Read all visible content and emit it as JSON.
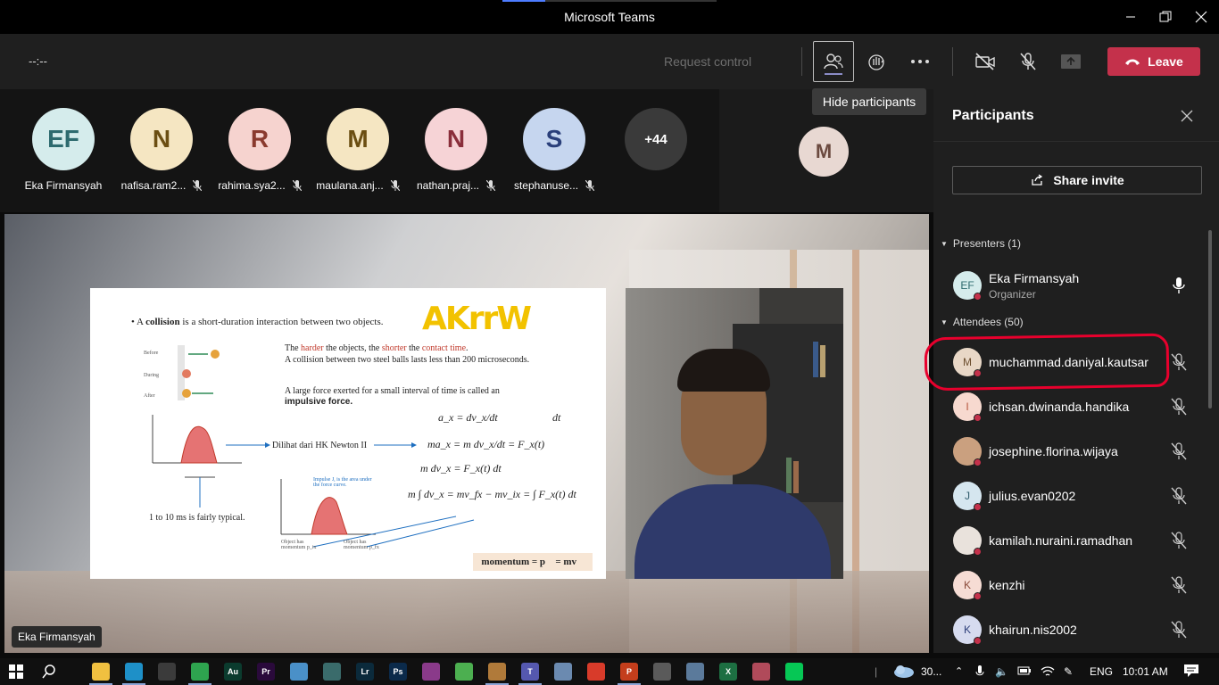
{
  "window": {
    "title": "Microsoft Teams"
  },
  "toolbar": {
    "timer": "--:--",
    "request_control": "Request control",
    "leave_label": "Leave",
    "tooltip": "Hide participants"
  },
  "strip": {
    "tiles": [
      {
        "initials": "EF",
        "name": "Eka Firmansyah",
        "bg": "#d5ecec",
        "fg": "#2e6b6f",
        "muted": false
      },
      {
        "initials": "N",
        "name": "nafisa.ram2...",
        "bg": "#f5e6c2",
        "fg": "#6b4e12",
        "muted": true
      },
      {
        "initials": "R",
        "name": "rahima.sya2...",
        "bg": "#f6d3cf",
        "fg": "#8a3a2e",
        "muted": true
      },
      {
        "initials": "M",
        "name": "maulana.anj...",
        "bg": "#f5e6c2",
        "fg": "#6b4e12",
        "muted": true
      },
      {
        "initials": "N",
        "name": "nathan.praj...",
        "bg": "#f6d3d6",
        "fg": "#8a2e3b",
        "muted": true
      },
      {
        "initials": "S",
        "name": "stephanuse...",
        "bg": "#c6d6ef",
        "fg": "#2a3f7a",
        "muted": true
      }
    ],
    "overflow": "+44",
    "right_avatar": "M"
  },
  "stage": {
    "presenter_chip": "Eka Firmansyah",
    "slide": {
      "bullet_pre": "A ",
      "bullet_bold": "collision",
      "bullet_post": " is a short-duration interaction between two objects.",
      "handwriting": "AKrrW",
      "line1_a": "The ",
      "line1_b": "harder",
      "line1_c": " the objects, the ",
      "line1_d": "shorter",
      "line1_e": " the ",
      "line1_f": "contact time",
      "line1_g": ".",
      "line2": "A collision between two steel balls lasts less than 200 microseconds.",
      "line3": "A large force exerted for a small interval of time is called an",
      "line4": "impulsive force.",
      "dilihat": "Dilihat dari HK Newton II",
      "typical": "1 to 10 ms is fairly typical.",
      "eq1": "a_x = dv_x/dt",
      "eq_dt": "dt",
      "eq2": "ma_x = m dv_x/dt = F_x(t)",
      "eq3": "m dv_x = F_x(t) dt",
      "eq4": "m ∫ dv_x = mv_fx − mv_ix = ∫ F_x(t) dt",
      "momentum": "momentum = p⃗ = mv⃗",
      "lbl_before": "Before",
      "lbl_during": "During",
      "lbl_after": "After",
      "lbl_impulse": "Impulse J, is the area under the force curve.",
      "lbl_obj1": "Object has momentum p_ix",
      "lbl_obj2": "Object has momentum p_fx"
    }
  },
  "panel": {
    "title": "Participants",
    "share_invite": "Share invite",
    "presenters_label": "Presenters (1)",
    "attendees_label": "Attendees (50)",
    "presenter": {
      "initials": "EF",
      "name": "Eka Firmansyah",
      "role": "Organizer"
    },
    "attendees": [
      {
        "initials": "M",
        "name": "muchammad.daniyal.kautsar",
        "bg": "#e8d7c6",
        "fg": "#6b4e2e"
      },
      {
        "initials": "I",
        "name": "ichsan.dwinanda.handika",
        "bg": "#f7d9cf",
        "fg": "#b5533b"
      },
      {
        "initials": "",
        "name": "josephine.florina.wijaya",
        "bg": "#caa07f",
        "fg": "#2b1d14"
      },
      {
        "initials": "J",
        "name": "julius.evan0202",
        "bg": "#d5e6ef",
        "fg": "#2e5a6b"
      },
      {
        "initials": "",
        "name": "kamilah.nuraini.ramadhan",
        "bg": "#e9e2dc",
        "fg": "#7a1d1d"
      },
      {
        "initials": "K",
        "name": "kenzhi",
        "bg": "#f6dcd4",
        "fg": "#8a4a3a"
      },
      {
        "initials": "K",
        "name": "khairun.nis2002",
        "bg": "#d6dbef",
        "fg": "#2e3f7a"
      }
    ]
  },
  "taskbar": {
    "icons": [
      {
        "name": "file-explorer-icon",
        "label": "",
        "color": "#f0c040"
      },
      {
        "name": "edge-icon",
        "label": "",
        "color": "#1e90c8"
      },
      {
        "name": "store-icon",
        "label": "",
        "color": "#3b3b3b"
      },
      {
        "name": "chrome-icon",
        "label": "",
        "color": "#2ea44f"
      },
      {
        "name": "audition-icon",
        "label": "Au",
        "color": "#0b3b2e"
      },
      {
        "name": "premiere-icon",
        "label": "Pr",
        "color": "#2a0a3b"
      },
      {
        "name": "notepad-icon",
        "label": "",
        "color": "#4a90c8"
      },
      {
        "name": "media-icon",
        "label": "",
        "color": "#3a6b6b"
      },
      {
        "name": "lightroom-icon",
        "label": "Lr",
        "color": "#0b2a3b"
      },
      {
        "name": "photoshop-icon",
        "label": "Ps",
        "color": "#0b2a4a"
      },
      {
        "name": "winrar-icon",
        "label": "",
        "color": "#8a3a8a"
      },
      {
        "name": "utorrent-icon",
        "label": "",
        "color": "#4caf50"
      },
      {
        "name": "app-icon",
        "label": "",
        "color": "#b07a3a"
      },
      {
        "name": "teams-icon",
        "label": "T",
        "color": "#5558af"
      },
      {
        "name": "paint-icon",
        "label": "",
        "color": "#6b8ab0"
      },
      {
        "name": "acrobat-icon",
        "label": "",
        "color": "#d83b2a"
      },
      {
        "name": "powerpoint-icon",
        "label": "P",
        "color": "#c43e1c"
      },
      {
        "name": "audio-icon",
        "label": "",
        "color": "#5a5a5a"
      },
      {
        "name": "network-app-icon",
        "label": "",
        "color": "#5b7a9b"
      },
      {
        "name": "excel-icon",
        "label": "X",
        "color": "#1d6f42"
      },
      {
        "name": "photos-icon",
        "label": "",
        "color": "#b04a5a"
      },
      {
        "name": "line-icon",
        "label": "",
        "color": "#06c755"
      }
    ],
    "weather": "30...",
    "language": "ENG",
    "time": "10:01 AM"
  }
}
